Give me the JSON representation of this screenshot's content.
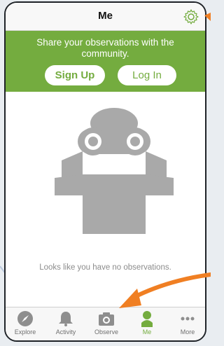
{
  "navbar": {
    "title": "Me"
  },
  "banner": {
    "message": "Share your observations with the community.",
    "signup_label": "Sign Up",
    "login_label": "Log In"
  },
  "main": {
    "empty_message": "Looks like you have no observations."
  },
  "tabs": [
    {
      "label": "Explore",
      "icon": "compass-icon"
    },
    {
      "label": "Activity",
      "icon": "bell-icon"
    },
    {
      "label": "Observe",
      "icon": "camera-icon"
    },
    {
      "label": "Me",
      "icon": "person-icon",
      "active": true
    },
    {
      "label": "More",
      "icon": "ellipsis-icon"
    }
  ],
  "colors": {
    "accent": "#74ac3f",
    "highlight_arrow": "#f07f23",
    "icon_gray": "#8e8e8e"
  }
}
